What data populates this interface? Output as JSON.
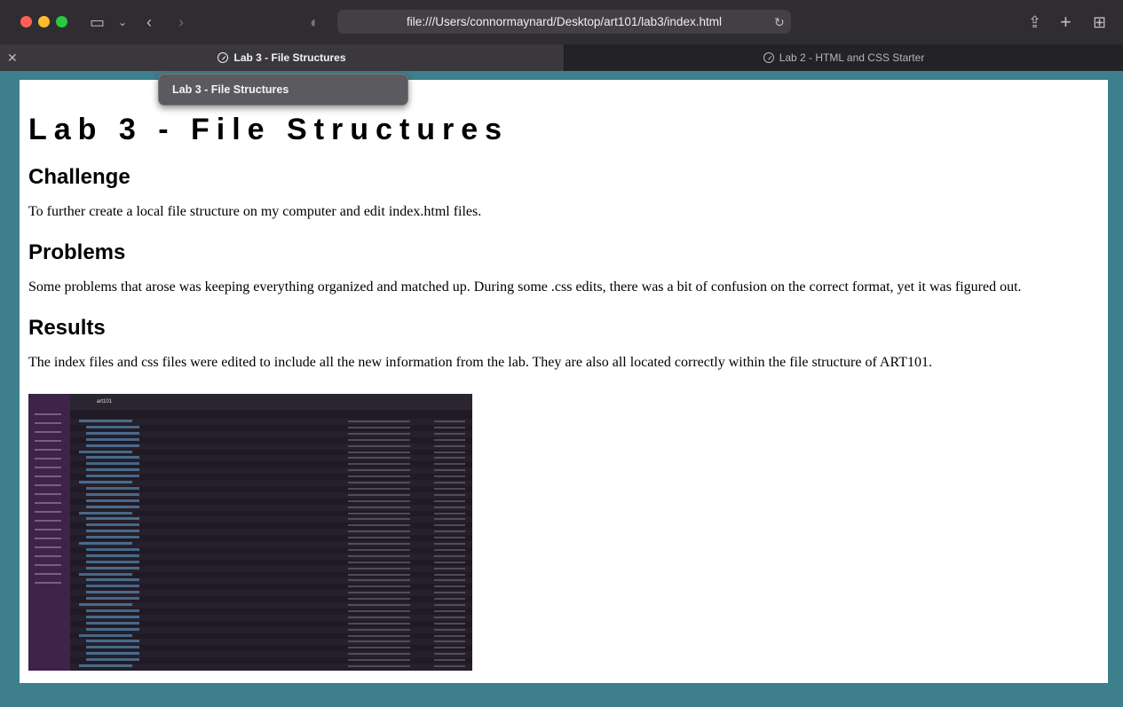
{
  "browser": {
    "url": "file:///Users/connormaynard/Desktop/art101/lab3/index.html",
    "tabs": [
      {
        "label": "Lab 3 - File Structures",
        "active": true
      },
      {
        "label": "Lab 2 - HTML and CSS Starter",
        "active": false
      }
    ],
    "tooltip": "Lab 3 - File Structures",
    "colors": {
      "close": "#ff5f57",
      "minimize": "#febc2e",
      "zoom": "#28c840",
      "desktop": "#3d7f8c"
    }
  },
  "page": {
    "title": "Lab 3 - File Structures",
    "sections": [
      {
        "heading": "Challenge",
        "body": "To further create a local file structure on my computer and edit index.html files."
      },
      {
        "heading": "Problems",
        "body": "Some problems that arose was keeping everything organized and matched up. During some .css edits, there was a bit of confusion on the correct format, yet it was figured out."
      },
      {
        "heading": "Results",
        "body": "The index files and css files were edited to include all the new information from the lab. They are also all located correctly within the file structure of ART101."
      }
    ],
    "screenshot": {
      "folder_title": "art101"
    }
  }
}
